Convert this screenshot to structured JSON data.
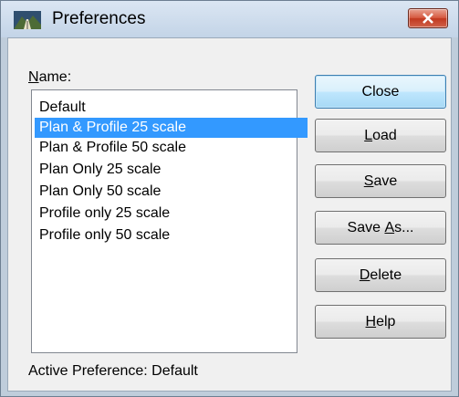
{
  "window": {
    "title": "Preferences"
  },
  "name_label": {
    "first": "N",
    "rest": "ame:"
  },
  "list": {
    "items": [
      "Default",
      "Plan & Profile 25 scale",
      "Plan & Profile 50 scale",
      "Plan Only 25 scale",
      "Plan Only 50 scale",
      "Profile only 25 scale",
      "Profile only 50 scale"
    ],
    "selected": "Plan & Profile 25 scale"
  },
  "buttons": {
    "close": "Close",
    "load": {
      "mnemonic": "L",
      "rest": "oad"
    },
    "save": {
      "mnemonic": "S",
      "rest": "ave"
    },
    "save_as": {
      "before": "Save ",
      "mnemonic": "A",
      "rest": "s..."
    },
    "delete": {
      "mnemonic": "D",
      "rest": "elete"
    },
    "help": {
      "mnemonic": "H",
      "rest": "elp"
    }
  },
  "status": {
    "active_preference": "Active Preference: Default"
  },
  "colors": {
    "selection": "#3399ff",
    "close_button": "#c1381f"
  },
  "icons": {
    "app": "landscape-road-icon",
    "close": "close-icon"
  }
}
